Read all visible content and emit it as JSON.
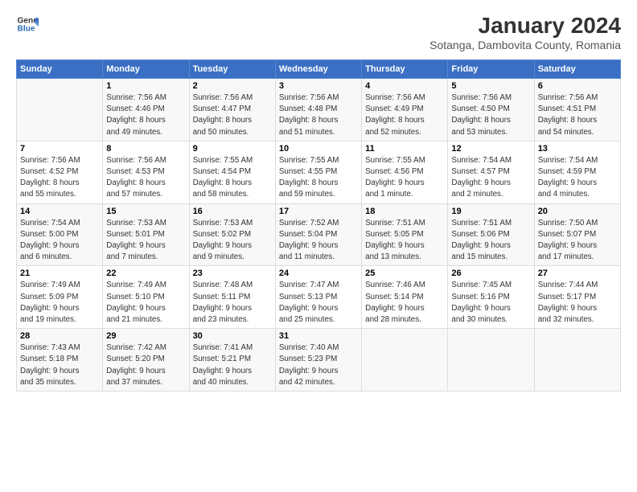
{
  "header": {
    "logo_line1": "General",
    "logo_line2": "Blue",
    "month_year": "January 2024",
    "location": "Sotanga, Dambovita County, Romania"
  },
  "days_of_week": [
    "Sunday",
    "Monday",
    "Tuesday",
    "Wednesday",
    "Thursday",
    "Friday",
    "Saturday"
  ],
  "weeks": [
    [
      {
        "day": "",
        "info": ""
      },
      {
        "day": "1",
        "info": "Sunrise: 7:56 AM\nSunset: 4:46 PM\nDaylight: 8 hours\nand 49 minutes."
      },
      {
        "day": "2",
        "info": "Sunrise: 7:56 AM\nSunset: 4:47 PM\nDaylight: 8 hours\nand 50 minutes."
      },
      {
        "day": "3",
        "info": "Sunrise: 7:56 AM\nSunset: 4:48 PM\nDaylight: 8 hours\nand 51 minutes."
      },
      {
        "day": "4",
        "info": "Sunrise: 7:56 AM\nSunset: 4:49 PM\nDaylight: 8 hours\nand 52 minutes."
      },
      {
        "day": "5",
        "info": "Sunrise: 7:56 AM\nSunset: 4:50 PM\nDaylight: 8 hours\nand 53 minutes."
      },
      {
        "day": "6",
        "info": "Sunrise: 7:56 AM\nSunset: 4:51 PM\nDaylight: 8 hours\nand 54 minutes."
      }
    ],
    [
      {
        "day": "7",
        "info": "Sunrise: 7:56 AM\nSunset: 4:52 PM\nDaylight: 8 hours\nand 55 minutes."
      },
      {
        "day": "8",
        "info": "Sunrise: 7:56 AM\nSunset: 4:53 PM\nDaylight: 8 hours\nand 57 minutes."
      },
      {
        "day": "9",
        "info": "Sunrise: 7:55 AM\nSunset: 4:54 PM\nDaylight: 8 hours\nand 58 minutes."
      },
      {
        "day": "10",
        "info": "Sunrise: 7:55 AM\nSunset: 4:55 PM\nDaylight: 8 hours\nand 59 minutes."
      },
      {
        "day": "11",
        "info": "Sunrise: 7:55 AM\nSunset: 4:56 PM\nDaylight: 9 hours\nand 1 minute."
      },
      {
        "day": "12",
        "info": "Sunrise: 7:54 AM\nSunset: 4:57 PM\nDaylight: 9 hours\nand 2 minutes."
      },
      {
        "day": "13",
        "info": "Sunrise: 7:54 AM\nSunset: 4:59 PM\nDaylight: 9 hours\nand 4 minutes."
      }
    ],
    [
      {
        "day": "14",
        "info": "Sunrise: 7:54 AM\nSunset: 5:00 PM\nDaylight: 9 hours\nand 6 minutes."
      },
      {
        "day": "15",
        "info": "Sunrise: 7:53 AM\nSunset: 5:01 PM\nDaylight: 9 hours\nand 7 minutes."
      },
      {
        "day": "16",
        "info": "Sunrise: 7:53 AM\nSunset: 5:02 PM\nDaylight: 9 hours\nand 9 minutes."
      },
      {
        "day": "17",
        "info": "Sunrise: 7:52 AM\nSunset: 5:04 PM\nDaylight: 9 hours\nand 11 minutes."
      },
      {
        "day": "18",
        "info": "Sunrise: 7:51 AM\nSunset: 5:05 PM\nDaylight: 9 hours\nand 13 minutes."
      },
      {
        "day": "19",
        "info": "Sunrise: 7:51 AM\nSunset: 5:06 PM\nDaylight: 9 hours\nand 15 minutes."
      },
      {
        "day": "20",
        "info": "Sunrise: 7:50 AM\nSunset: 5:07 PM\nDaylight: 9 hours\nand 17 minutes."
      }
    ],
    [
      {
        "day": "21",
        "info": "Sunrise: 7:49 AM\nSunset: 5:09 PM\nDaylight: 9 hours\nand 19 minutes."
      },
      {
        "day": "22",
        "info": "Sunrise: 7:49 AM\nSunset: 5:10 PM\nDaylight: 9 hours\nand 21 minutes."
      },
      {
        "day": "23",
        "info": "Sunrise: 7:48 AM\nSunset: 5:11 PM\nDaylight: 9 hours\nand 23 minutes."
      },
      {
        "day": "24",
        "info": "Sunrise: 7:47 AM\nSunset: 5:13 PM\nDaylight: 9 hours\nand 25 minutes."
      },
      {
        "day": "25",
        "info": "Sunrise: 7:46 AM\nSunset: 5:14 PM\nDaylight: 9 hours\nand 28 minutes."
      },
      {
        "day": "26",
        "info": "Sunrise: 7:45 AM\nSunset: 5:16 PM\nDaylight: 9 hours\nand 30 minutes."
      },
      {
        "day": "27",
        "info": "Sunrise: 7:44 AM\nSunset: 5:17 PM\nDaylight: 9 hours\nand 32 minutes."
      }
    ],
    [
      {
        "day": "28",
        "info": "Sunrise: 7:43 AM\nSunset: 5:18 PM\nDaylight: 9 hours\nand 35 minutes."
      },
      {
        "day": "29",
        "info": "Sunrise: 7:42 AM\nSunset: 5:20 PM\nDaylight: 9 hours\nand 37 minutes."
      },
      {
        "day": "30",
        "info": "Sunrise: 7:41 AM\nSunset: 5:21 PM\nDaylight: 9 hours\nand 40 minutes."
      },
      {
        "day": "31",
        "info": "Sunrise: 7:40 AM\nSunset: 5:23 PM\nDaylight: 9 hours\nand 42 minutes."
      },
      {
        "day": "",
        "info": ""
      },
      {
        "day": "",
        "info": ""
      },
      {
        "day": "",
        "info": ""
      }
    ]
  ]
}
